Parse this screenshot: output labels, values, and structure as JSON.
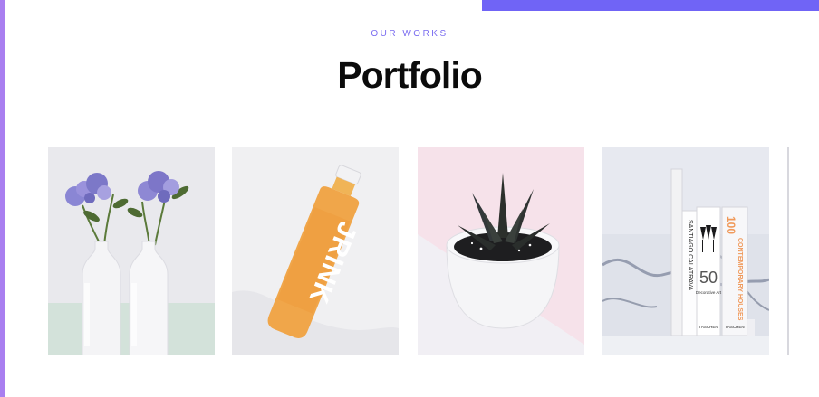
{
  "section": {
    "eyebrow": "OUR WORKS",
    "title": "Portfolio"
  },
  "portfolio": {
    "items": [
      {
        "subject": "hydrangea-vases"
      },
      {
        "subject": "juice-bottle",
        "label": "JRINK"
      },
      {
        "subject": "succulent-pot"
      },
      {
        "subject": "books",
        "books": [
          {
            "author": "SANTIAGO CALATRAVA",
            "number": "50",
            "title": "Decorative Art",
            "publisher": "TASCHEN"
          },
          {
            "number": "100",
            "title": "CONTEMPORARY HOUSES",
            "publisher": "TASCHEN"
          }
        ]
      }
    ]
  },
  "colors": {
    "accent_purple": "#7064f6",
    "accent_violet": "#a97ff0",
    "eyebrow": "#7a6cf0",
    "title": "#0b0b0b"
  }
}
